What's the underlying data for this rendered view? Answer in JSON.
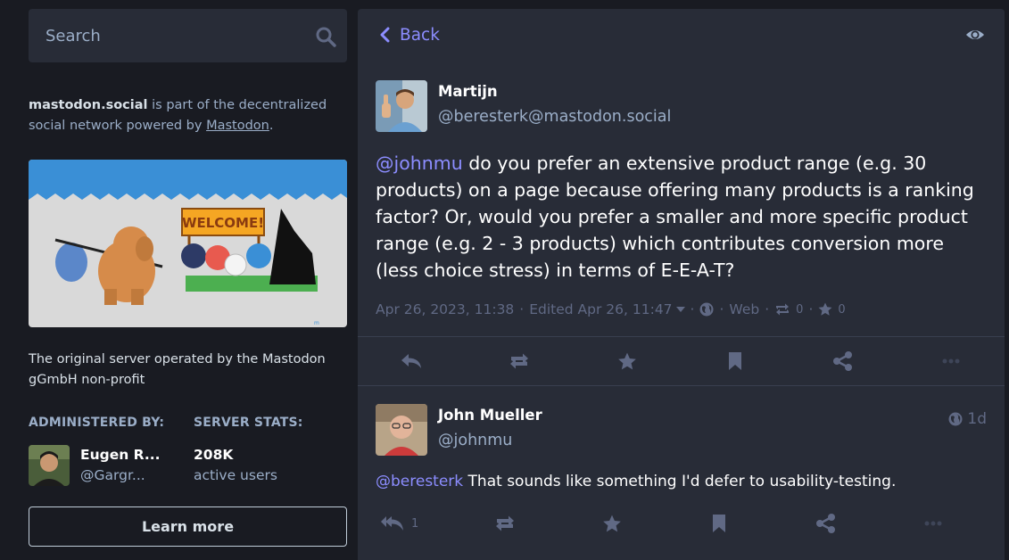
{
  "search": {
    "placeholder": "Search"
  },
  "about": {
    "server": "mastodon.social",
    "text_before": " is part of the decentralized social network powered by ",
    "link": "Mastodon",
    "text_after": "."
  },
  "server_description": "The original server operated by the Mastodon gGmbH non-profit",
  "administered_by": {
    "heading": "ADMINISTERED BY:",
    "display_name": "Eugen R...",
    "username": "@Gargr..."
  },
  "server_stats": {
    "heading": "SERVER STATS:",
    "value": "208K",
    "label": "active users"
  },
  "learn_more": "Learn more",
  "hero_banner": {
    "sign_text": "WELCOME!"
  },
  "topbar": {
    "back": "Back"
  },
  "status": {
    "display_name": "Martijn",
    "username": "@beresterk@mastodon.social",
    "mention": "@johnmu",
    "body": " do you prefer an extensive product range (e.g. 30 products) on a page because offering many products is a ranking factor? Or, would you prefer a smaller and more specific product range (e.g. 2 - 3 products) which contributes conversion more (less choice stress) in terms of E-E-A-T?",
    "date": "Apr 26, 2023, 11:38",
    "edited": "Edited Apr 26, 11:47",
    "app": "Web",
    "reblogs": "0",
    "favourites": "0"
  },
  "reply": {
    "display_name": "John Mueller",
    "username": "@johnmu",
    "time": "1d",
    "mention": "@beresterk",
    "body": " That sounds like something I'd defer to usability-testing.",
    "replies_count": "1"
  },
  "colors": {
    "background": "#191b22",
    "panel": "#282c37",
    "accent": "#8c8dff",
    "muted": "#9baec8",
    "dim": "#606984"
  }
}
